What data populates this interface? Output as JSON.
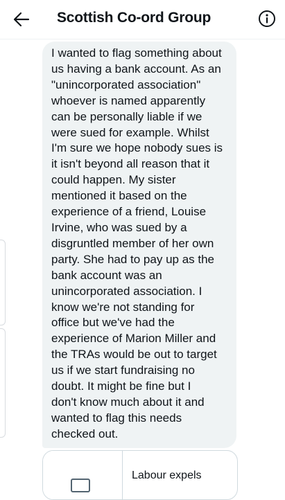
{
  "header": {
    "title": "Scottish Co-ord Group",
    "back_icon": "arrow-left-icon",
    "info_icon": "info-circle-icon"
  },
  "message": {
    "text": "I wanted to flag something about\nus having a bank account.  As an\n\"unincorporated association\"\nwhoever is named apparently\ncan be personally liable if we\nwere sued for example.  Whilst\nI'm sure we hope nobody sues is\nit isn't beyond all reason that it\ncould happen.  My sister\nmentioned it based on the\nexperience of a friend, Louise\nIrvine, who was sued by a\ndisgruntled member of her own\nparty.  She had to pay up as the\nbank account was an\nunincorporated association.  I\nknow we're not standing for\noffice but we've had the\nexperience of Marion Miller and\nthe TRAs would be out to target\nus if we start fundraising no\ndoubt.  It might be fine but I\ndon't know much about it and\nwanted to flag this needs\nchecked out."
  },
  "link_card": {
    "title": "Labour expels"
  },
  "colors": {
    "bubble_bg": "#eff3f4",
    "text": "#0f1419",
    "border": "#cfd9de"
  }
}
